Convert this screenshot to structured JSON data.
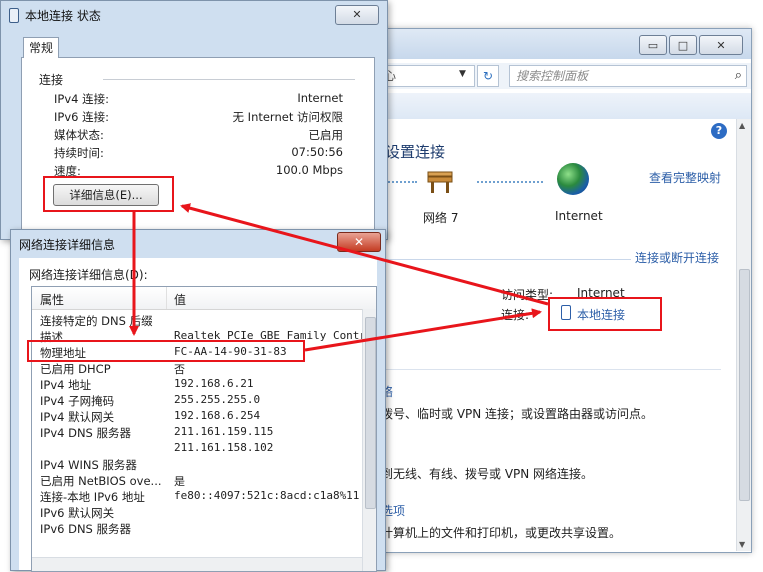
{
  "control_panel": {
    "address_partial": "心",
    "search_placeholder": "搜索控制面板",
    "help_label": "?",
    "heading_partial": "设置连接",
    "full_map_link": "查看完整映射",
    "network_name": "网络 7",
    "internet_label": "Internet",
    "connect_link": "连接或断开连接",
    "access_type_label": "访问类型:",
    "access_type_value": "Internet",
    "connection_label": "连接:",
    "connection_value": "本地连接",
    "items": [
      {
        "text": "络",
        "link": true
      },
      {
        "text": "拨号、临时或 VPN 连接；或设置路由器或访问点。",
        "link": false
      },
      {
        "text": "到无线、有线、拨号或 VPN 网络连接。",
        "link": false
      },
      {
        "text": "选项",
        "link": true
      },
      {
        "text": "计算机上的文件和打印机，或更改共享设置。",
        "link": false
      }
    ]
  },
  "status_dialog": {
    "title": "本地连接 状态",
    "close_label": "✕",
    "tab": "常规",
    "group_label": "连接",
    "rows": [
      {
        "label": "IPv4 连接:",
        "value": "Internet"
      },
      {
        "label": "IPv6 连接:",
        "value": "无 Internet 访问权限"
      },
      {
        "label": "媒体状态:",
        "value": "已启用"
      },
      {
        "label": "持续时间:",
        "value": "07:50:56"
      },
      {
        "label": "速度:",
        "value": "100.0 Mbps"
      }
    ],
    "details_button": "详细信息(E)..."
  },
  "details_dialog": {
    "title": "网络连接详细信息",
    "close_label": "✕",
    "heading": "网络连接详细信息(D):",
    "col_property": "属性",
    "col_value": "值",
    "rows": [
      {
        "p": "连接特定的 DNS 后缀",
        "v": ""
      },
      {
        "p": "描述",
        "v": "Realtek PCIe GBE Family Controlle"
      },
      {
        "p": "物理地址",
        "v": "FC-AA-14-90-31-83"
      },
      {
        "p": "已启用 DHCP",
        "v": "否"
      },
      {
        "p": "IPv4 地址",
        "v": "192.168.6.21"
      },
      {
        "p": "IPv4 子网掩码",
        "v": "255.255.255.0"
      },
      {
        "p": "IPv4 默认网关",
        "v": "192.168.6.254"
      },
      {
        "p": "IPv4 DNS 服务器",
        "v": "211.161.159.115"
      },
      {
        "p": "",
        "v": "211.161.158.102"
      },
      {
        "p": "IPv4 WINS 服务器",
        "v": ""
      },
      {
        "p": "已启用 NetBIOS ove...",
        "v": "是"
      },
      {
        "p": "连接-本地 IPv6 地址",
        "v": "fe80::4097:521c:8acd:c1a8%11"
      },
      {
        "p": "IPv6 默认网关",
        "v": ""
      },
      {
        "p": "IPv6 DNS 服务器",
        "v": ""
      }
    ]
  },
  "annotation_color": "#e8151b"
}
